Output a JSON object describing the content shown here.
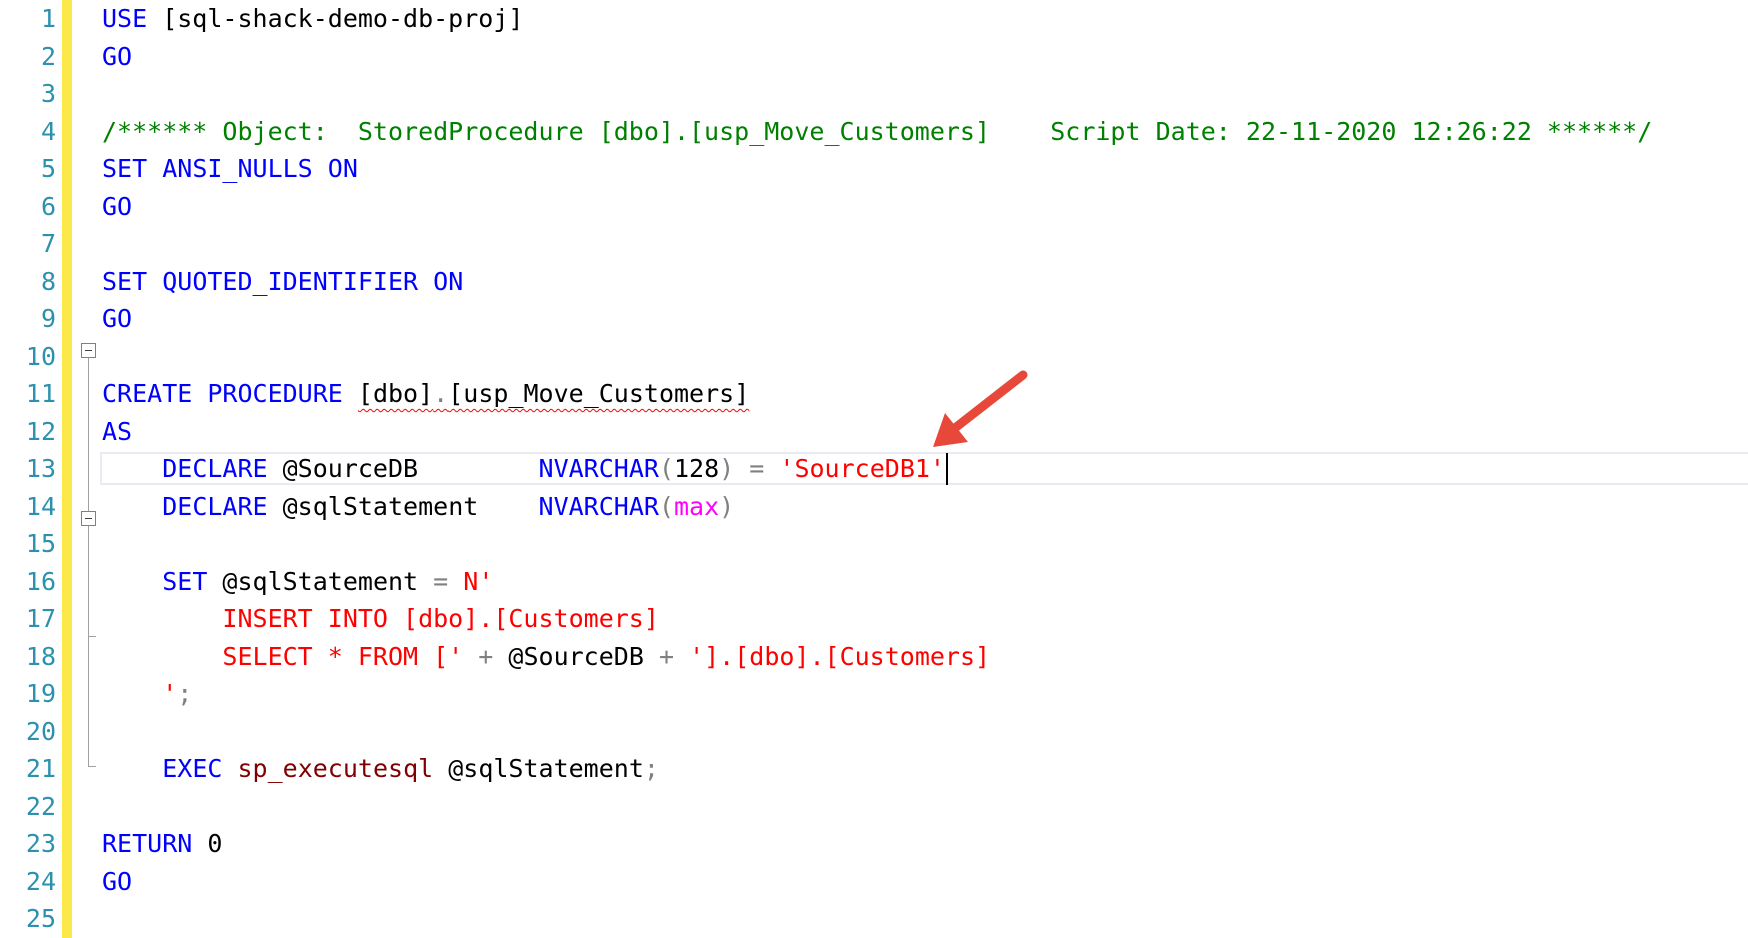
{
  "editor": {
    "lines": [
      {
        "n": "1",
        "segments": [
          {
            "t": "USE",
            "c": "kw"
          },
          {
            "t": " [sql-shack-demo-db-proj]",
            "c": "plain"
          }
        ]
      },
      {
        "n": "2",
        "segments": [
          {
            "t": "GO",
            "c": "kw"
          }
        ]
      },
      {
        "n": "3",
        "segments": []
      },
      {
        "n": "4",
        "segments": [
          {
            "t": "/****** Object:  StoredProcedure [dbo].[usp_Move_Customers]    Script Date: 22-11-2020 12:26:22 ******/",
            "c": "cmt"
          }
        ]
      },
      {
        "n": "5",
        "segments": [
          {
            "t": "SET",
            "c": "kw"
          },
          {
            "t": " ",
            "c": "plain"
          },
          {
            "t": "ANSI_NULLS",
            "c": "kw"
          },
          {
            "t": " ",
            "c": "plain"
          },
          {
            "t": "ON",
            "c": "kw"
          }
        ]
      },
      {
        "n": "6",
        "segments": [
          {
            "t": "GO",
            "c": "kw"
          }
        ]
      },
      {
        "n": "7",
        "segments": []
      },
      {
        "n": "8",
        "segments": [
          {
            "t": "SET",
            "c": "kw"
          },
          {
            "t": " ",
            "c": "plain"
          },
          {
            "t": "QUOTED_IDENTIFIER",
            "c": "kw"
          },
          {
            "t": " ",
            "c": "plain"
          },
          {
            "t": "ON",
            "c": "kw"
          }
        ]
      },
      {
        "n": "9",
        "segments": [
          {
            "t": "GO",
            "c": "kw"
          }
        ]
      },
      {
        "n": "10",
        "segments": []
      },
      {
        "n": "11",
        "segments": [
          {
            "t": "CREATE",
            "c": "kw"
          },
          {
            "t": " ",
            "c": "plain"
          },
          {
            "t": "PROCEDURE",
            "c": "kw"
          },
          {
            "t": " ",
            "c": "plain"
          },
          {
            "t": "[dbo]",
            "c": "plain sq"
          },
          {
            "t": ".",
            "c": "op sq"
          },
          {
            "t": "[usp_Move_Customers]",
            "c": "plain sq"
          }
        ]
      },
      {
        "n": "12",
        "segments": [
          {
            "t": "AS",
            "c": "kw"
          }
        ]
      },
      {
        "n": "13",
        "segments": [
          {
            "t": "    ",
            "c": "plain"
          },
          {
            "t": "DECLARE",
            "c": "kw"
          },
          {
            "t": " @SourceDB        ",
            "c": "plain"
          },
          {
            "t": "NVARCHAR",
            "c": "kw"
          },
          {
            "t": "(",
            "c": "op"
          },
          {
            "t": "128",
            "c": "plain"
          },
          {
            "t": ")",
            "c": "op"
          },
          {
            "t": " ",
            "c": "plain"
          },
          {
            "t": "=",
            "c": "op"
          },
          {
            "t": " ",
            "c": "plain"
          },
          {
            "t": "'SourceDB1'",
            "c": "str",
            "caret": true
          }
        ]
      },
      {
        "n": "14",
        "segments": [
          {
            "t": "    ",
            "c": "plain"
          },
          {
            "t": "DECLARE",
            "c": "kw"
          },
          {
            "t": " @sqlStatement    ",
            "c": "plain"
          },
          {
            "t": "NVARCHAR",
            "c": "kw"
          },
          {
            "t": "(",
            "c": "op"
          },
          {
            "t": "max",
            "c": "mag"
          },
          {
            "t": ")",
            "c": "op"
          }
        ]
      },
      {
        "n": "15",
        "segments": []
      },
      {
        "n": "16",
        "segments": [
          {
            "t": "    ",
            "c": "plain"
          },
          {
            "t": "SET",
            "c": "kw"
          },
          {
            "t": " @sqlStatement ",
            "c": "plain"
          },
          {
            "t": "=",
            "c": "op"
          },
          {
            "t": " ",
            "c": "plain"
          },
          {
            "t": "N'",
            "c": "str"
          }
        ]
      },
      {
        "n": "17",
        "segments": [
          {
            "t": "        INSERT INTO [dbo].[Customers]",
            "c": "str"
          }
        ]
      },
      {
        "n": "18",
        "segments": [
          {
            "t": "        SELECT * FROM ['",
            "c": "str"
          },
          {
            "t": " ",
            "c": "plain"
          },
          {
            "t": "+",
            "c": "op"
          },
          {
            "t": " @SourceDB ",
            "c": "plain"
          },
          {
            "t": "+",
            "c": "op"
          },
          {
            "t": " ",
            "c": "plain"
          },
          {
            "t": "'].[dbo].[Customers]",
            "c": "str"
          }
        ]
      },
      {
        "n": "19",
        "segments": [
          {
            "t": "    ",
            "c": "plain"
          },
          {
            "t": "'",
            "c": "str"
          },
          {
            "t": ";",
            "c": "op"
          }
        ]
      },
      {
        "n": "20",
        "segments": []
      },
      {
        "n": "21",
        "segments": [
          {
            "t": "    ",
            "c": "plain"
          },
          {
            "t": "EXEC",
            "c": "kw"
          },
          {
            "t": " ",
            "c": "plain"
          },
          {
            "t": "sp_executesql",
            "c": "fn"
          },
          {
            "t": " @sqlStatement",
            "c": "plain"
          },
          {
            "t": ";",
            "c": "op"
          }
        ]
      },
      {
        "n": "22",
        "segments": []
      },
      {
        "n": "23",
        "segments": [
          {
            "t": "RETURN",
            "c": "kw"
          },
          {
            "t": " 0",
            "c": "plain"
          }
        ]
      },
      {
        "n": "24",
        "segments": [
          {
            "t": "GO",
            "c": "kw"
          }
        ]
      },
      {
        "n": "25",
        "segments": []
      }
    ],
    "current_line": 13
  },
  "colors": {
    "keyword": "#0000ff",
    "string": "#ff0000",
    "comment": "#008000",
    "line_number": "#2b91af",
    "change_bar": "#fbe94a",
    "annotation_arrow": "#e8483a"
  }
}
